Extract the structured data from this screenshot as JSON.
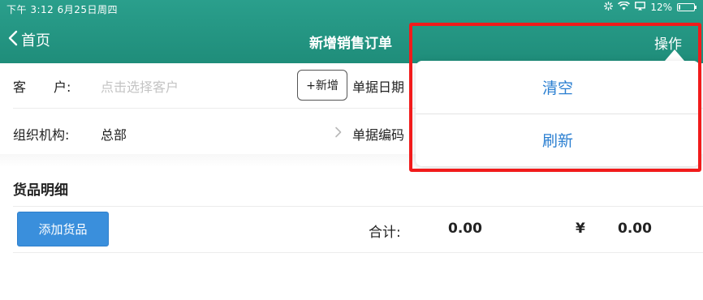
{
  "status_bar": {
    "time": "下午 3:12   6月25日周四",
    "battery_text": "12%",
    "battery_level": 0.12
  },
  "nav": {
    "back_label": "首页",
    "title": "新增销售订单",
    "actions_label": "操作"
  },
  "form": {
    "customer_label": "客户:",
    "customer_placeholder": "点击选择客户",
    "add_new_label": "+新增",
    "document_date_label": "单据日期",
    "org_label": "组织机构:",
    "org_value": "总部",
    "document_no_label": "单据编码"
  },
  "goods": {
    "section_title": "货品明细",
    "add_goods_label": "添加货品",
    "total_label": "合计:",
    "total_quantity": "0.00",
    "currency_symbol": "¥",
    "total_amount": "0.00"
  },
  "dropdown": {
    "items": [
      {
        "label": "清空"
      },
      {
        "label": "刷新"
      }
    ]
  },
  "colors": {
    "header": "#1f8d7a",
    "accent_blue": "#2b7fd1",
    "button_blue": "#3a8fdc",
    "highlight_red": "#f11b1b"
  }
}
